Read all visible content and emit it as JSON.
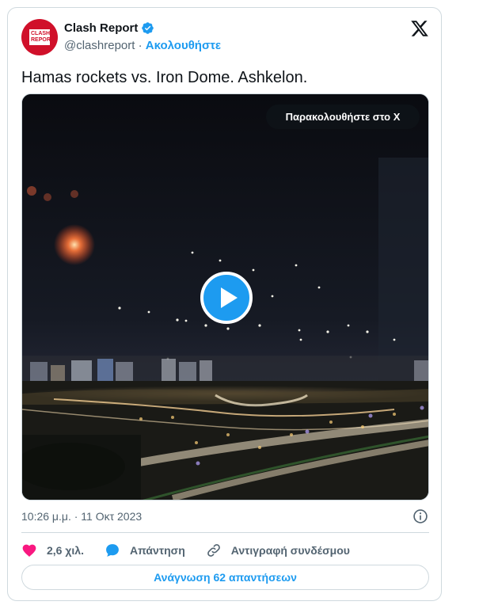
{
  "author": {
    "name": "Clash Report",
    "handle": "@clashreport",
    "separator": "·",
    "follow_label": "Ακολουθήστε",
    "avatar_text_line1": "CLASH",
    "avatar_text_line2": "REPORT",
    "verified_icon": "verified-badge-icon",
    "avatar_color": "#d0102a"
  },
  "platform_logo": "x-logo",
  "tweet": {
    "text": "Hamas rockets vs. Iron Dome. Ashkelon.",
    "timestamp": "10:26 μ.μ. · 11 Οκτ 2023"
  },
  "media": {
    "type": "video",
    "watch_on_x_label": "Παρακολουθήστε στο X",
    "play_icon": "play-icon"
  },
  "actions": {
    "likes": "2,6 χιλ.",
    "reply_label": "Απάντηση",
    "copy_link_label": "Αντιγραφή συνδέσμου"
  },
  "read_replies_label": "Ανάγνωση 62 απαντήσεων",
  "colors": {
    "accent": "#1d9bf0",
    "like": "#f91880",
    "muted_text": "#536471",
    "border": "#cfd9de"
  }
}
